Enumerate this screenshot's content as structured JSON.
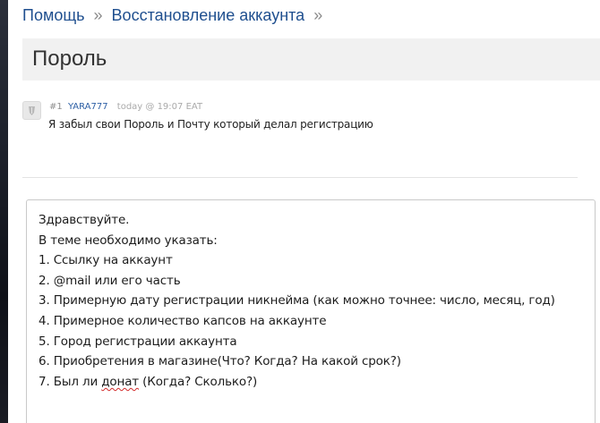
{
  "breadcrumb": {
    "items": [
      "Помощь",
      "Восстановление аккаунта"
    ],
    "separator": "»"
  },
  "topic": {
    "title": "Пороль"
  },
  "post": {
    "number": "#1",
    "author": "YARA777",
    "time": "today @ 19:07 EAT",
    "text": "Я забыл свои Пороль и Почту который делал регистрацию"
  },
  "reply": {
    "lines": [
      "Здравствуйте.",
      "В теме необходимо указать:",
      "1. Ссылку на аккаунт",
      "2. @mail или его часть",
      "3. Примерную дату регистрации никнейма (как можно точнее: число, месяц, год)",
      "4. Примерное количество капсов на аккаунте",
      "5. Город регистрации аккаунта",
      "6. Приобретения в магазине(Что? Когда? На какой срок?)"
    ],
    "last_line": {
      "before": "7. Был ли ",
      "misspelled": "донат",
      "after": " (Когда? Сколько?)"
    }
  },
  "colors": {
    "link": "#1f4f8f",
    "username": "#2d5fa5",
    "title_bar": "#f1f1f1",
    "spellcheck": "#d22b2b"
  }
}
